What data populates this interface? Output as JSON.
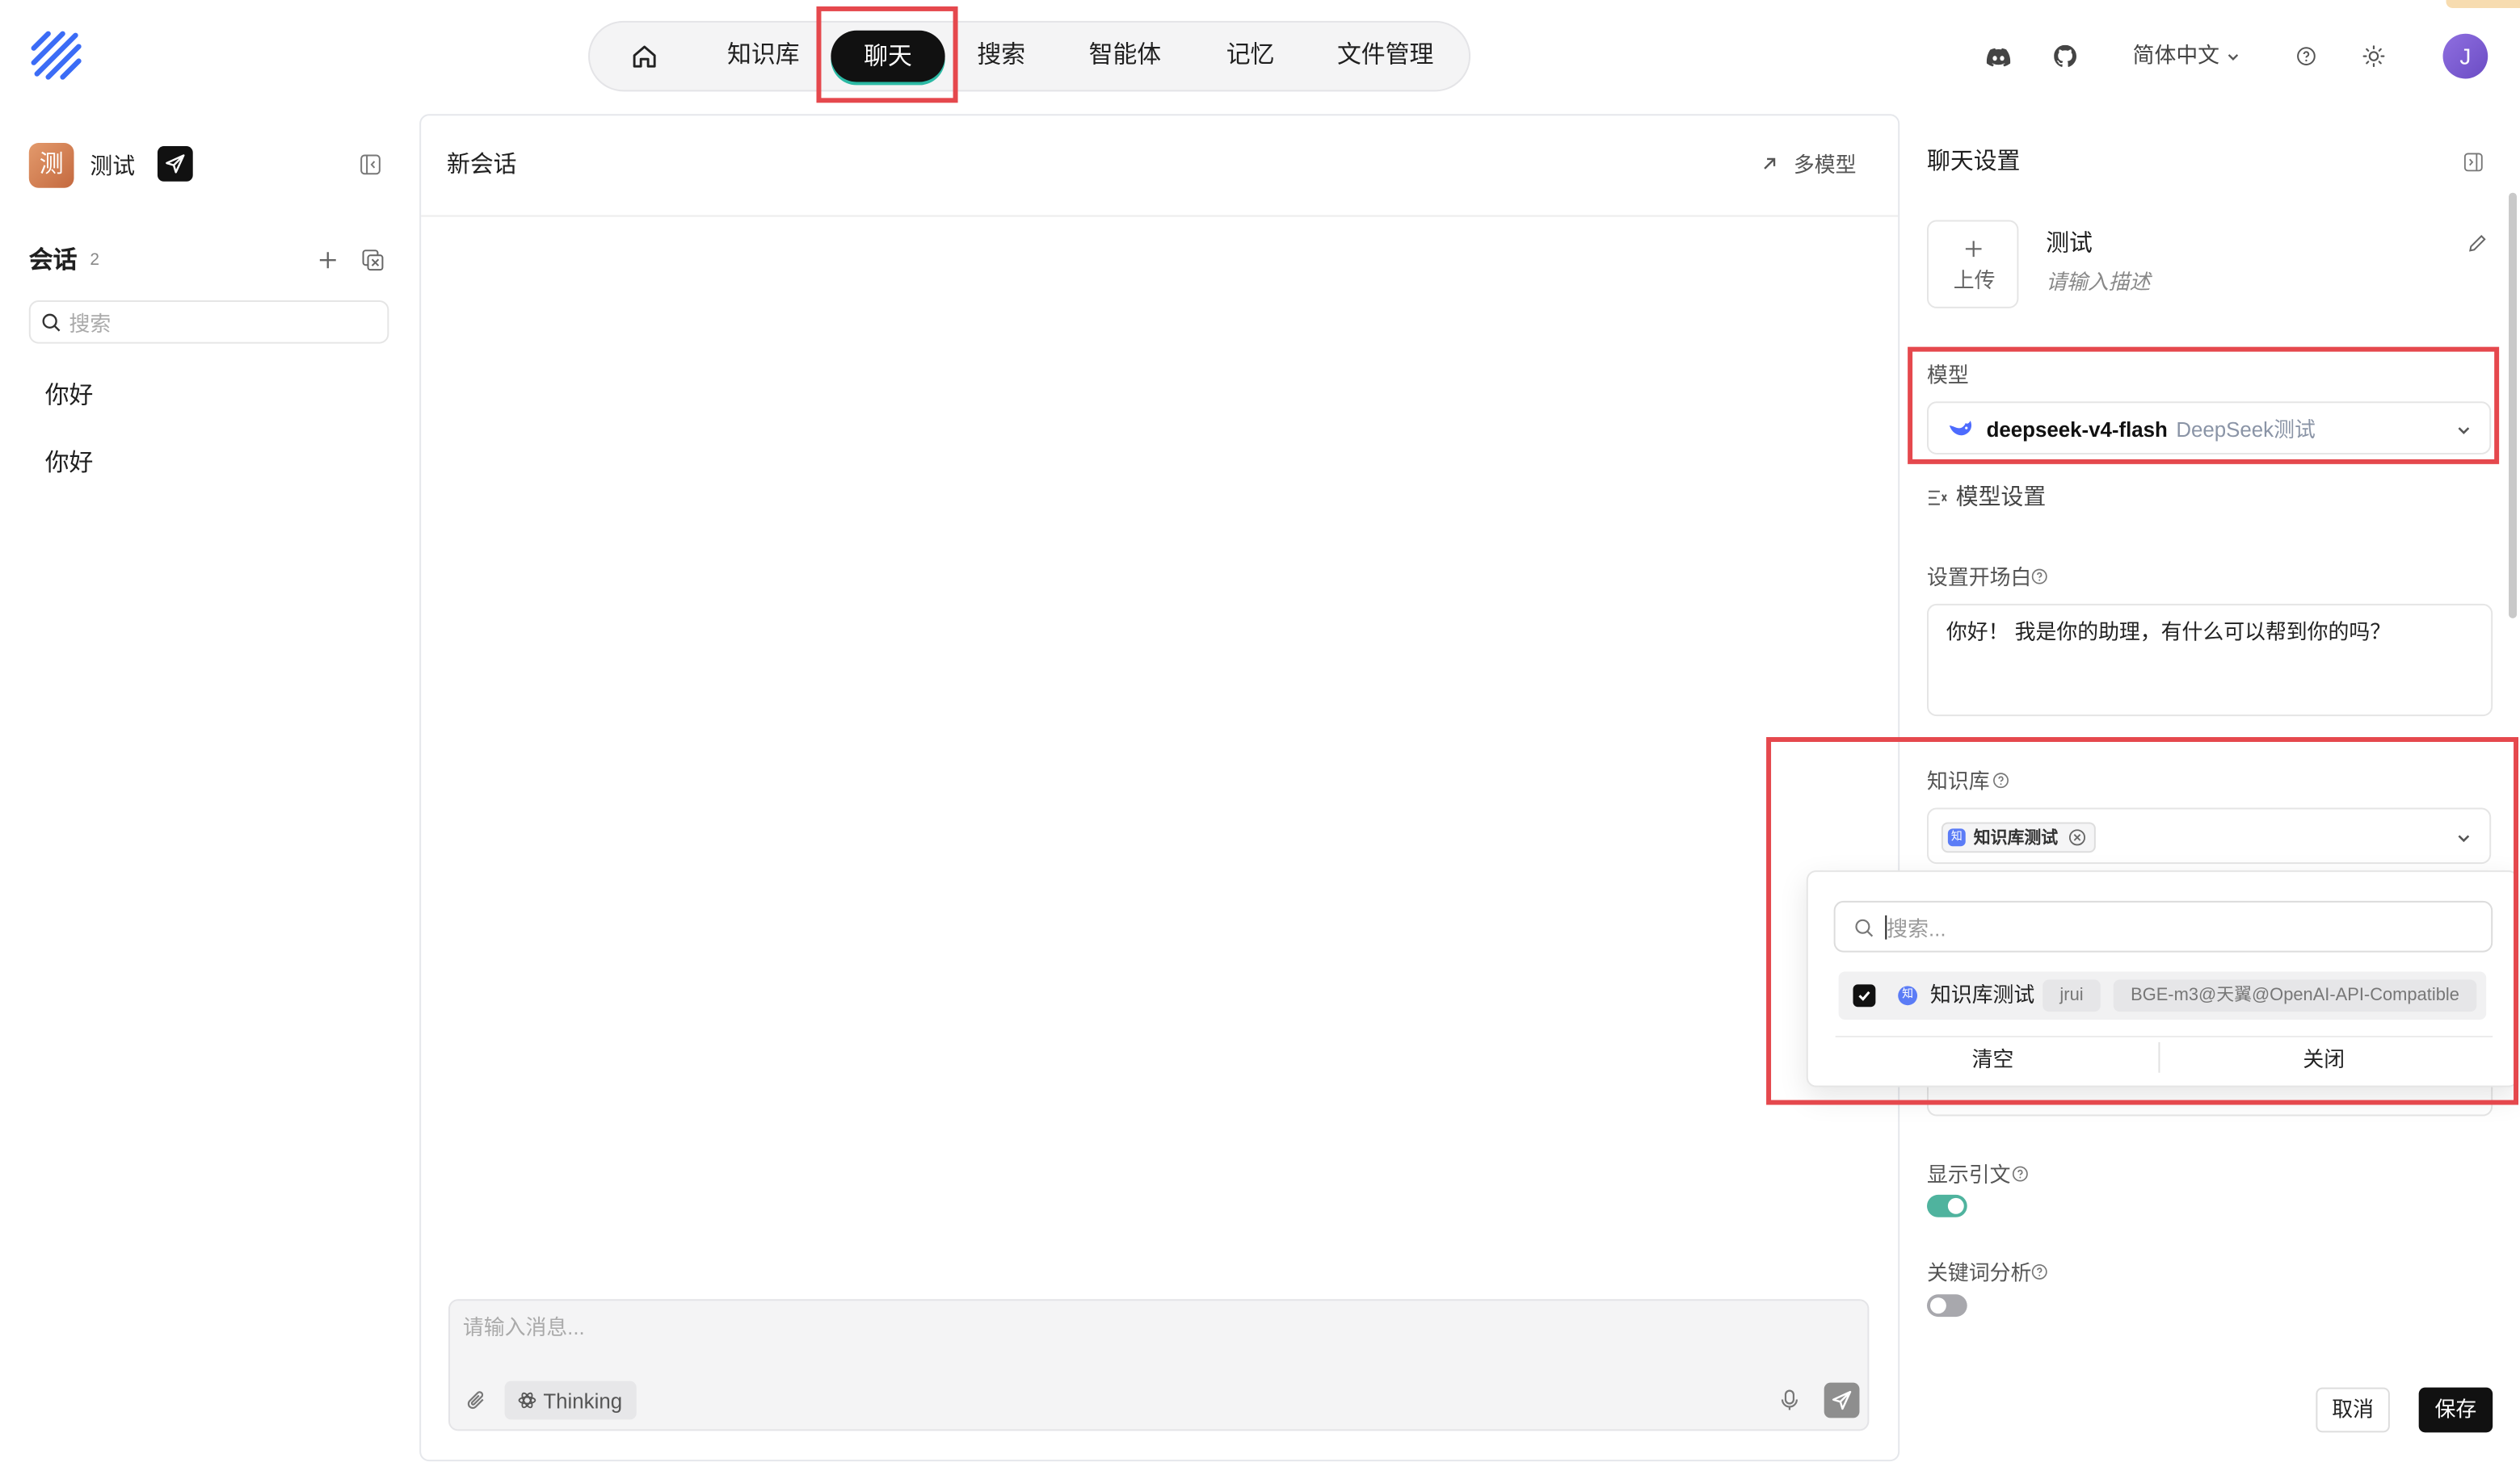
{
  "nav": {
    "items": [
      {
        "icon": "home-icon"
      },
      {
        "label": "知识库"
      },
      {
        "label": "聊天",
        "active": true
      },
      {
        "label": "搜索"
      },
      {
        "label": "智能体"
      },
      {
        "label": "记忆"
      },
      {
        "label": "文件管理"
      }
    ]
  },
  "header_right": {
    "icons": [
      "discord-icon",
      "github-icon",
      "help-icon",
      "sun-icon"
    ],
    "language": "简体中文",
    "avatar_initial": "J"
  },
  "sidebar": {
    "assistant": {
      "avatar_char": "测",
      "name": "测试"
    },
    "conversations": {
      "title": "会话",
      "count": "2",
      "search_placeholder": "搜索",
      "items": [
        "你好",
        "你好"
      ]
    }
  },
  "chat": {
    "title": "新会话",
    "multi_model": "多模型",
    "input_placeholder": "请输入消息...",
    "thinking": "Thinking"
  },
  "settings": {
    "title": "聊天设置",
    "upload": "上传",
    "name": "测试",
    "description_placeholder": "请输入描述",
    "model_label": "模型",
    "model_name": "deepseek-v4-flash",
    "model_provider": "DeepSeek测试",
    "model_settings": "模型设置",
    "opening_label": "设置开场白",
    "opening_text": "你好！ 我是你的助理，有什么可以帮到你的吗？",
    "kb_label": "知识库",
    "kb_icon_char": "知",
    "kb_selected": "知识库测试",
    "kb_dropdown": {
      "search_placeholder": "搜索...",
      "options": [
        {
          "icon_char": "知",
          "name": "知识库测试",
          "owner": "jrui",
          "embedding": "BGE-m3@天翼@OpenAI-API-Compatible",
          "checked": true
        }
      ],
      "clear": "清空",
      "close": "关闭"
    },
    "show_citation": {
      "label": "显示引文",
      "enabled": true
    },
    "keyword_analysis": {
      "label": "关键词分析",
      "enabled": false
    },
    "cancel": "取消",
    "save": "保存"
  },
  "colors": {
    "accent": "#111111",
    "brand_blue": "#3b6cf6",
    "highlight_red": "#e5484d",
    "toggle_on": "#4fb39e",
    "avatar_purple": "#7c5cd6"
  }
}
